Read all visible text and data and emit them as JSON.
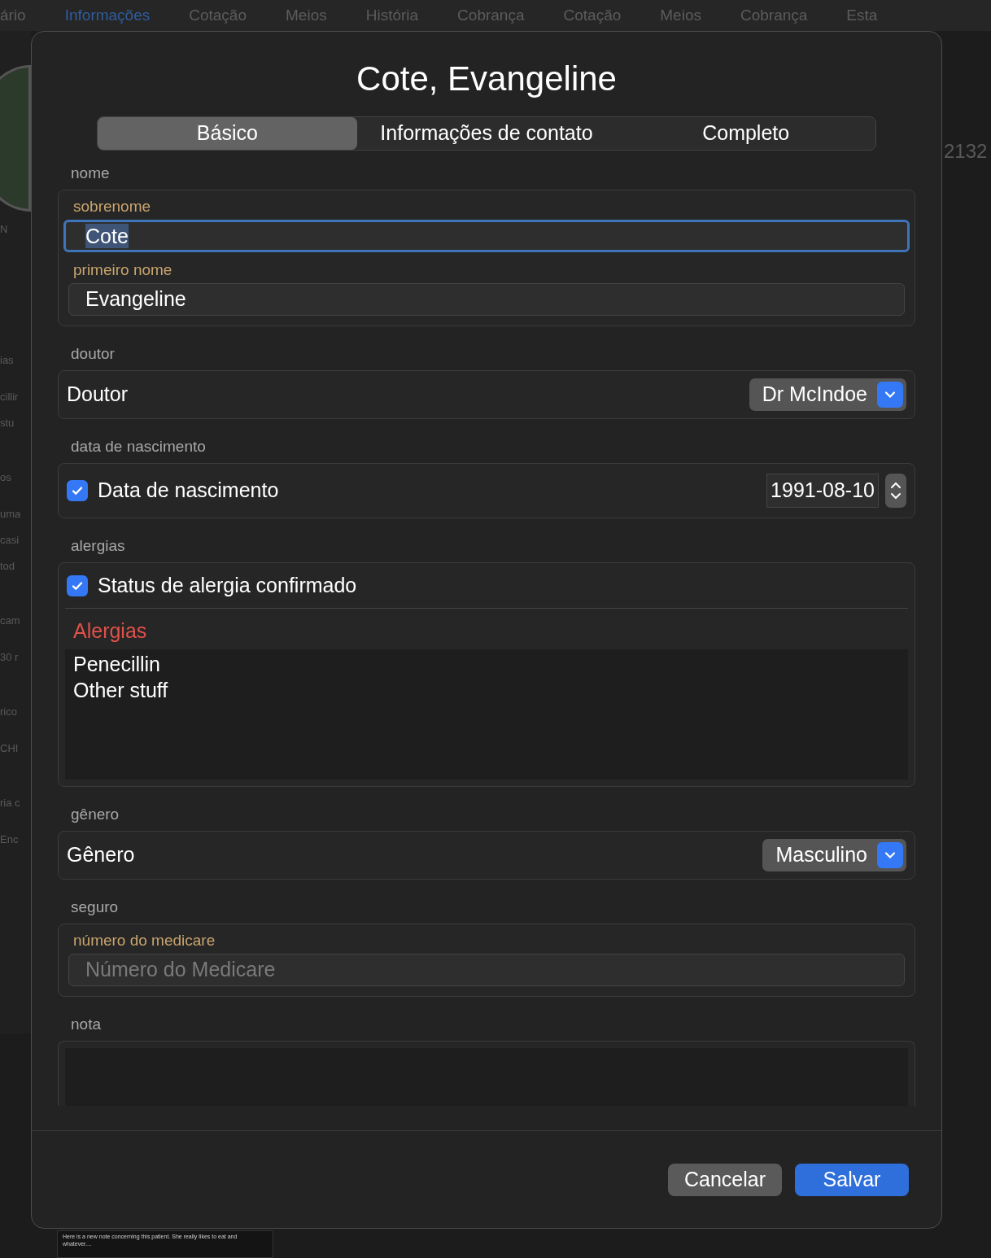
{
  "toolbar": {
    "items": [
      {
        "label": "ário",
        "selected": false
      },
      {
        "label": "Informações",
        "selected": true
      },
      {
        "label": "Cotação",
        "selected": false
      },
      {
        "label": "Meios",
        "selected": false
      },
      {
        "label": "História",
        "selected": false
      },
      {
        "label": "Cobrança",
        "selected": false
      },
      {
        "label": "Cotação",
        "selected": false
      },
      {
        "label": "Meios",
        "selected": false
      },
      {
        "label": "Cobrança",
        "selected": false
      },
      {
        "label": "Esta",
        "selected": false
      }
    ]
  },
  "background_column": [
    "N",
    "ias",
    "cillir",
    "stu",
    "os",
    "uma",
    "casi",
    "tod",
    "cam",
    "30 r",
    "rico",
    "CHI",
    "ria c",
    "Enc"
  ],
  "background_value": "2132",
  "background_note": "Here is a new note concerning this patient. She really likes to eat and whatever....",
  "dialog": {
    "title": "Cote, Evangeline",
    "tabs": [
      {
        "label": "Básico",
        "selected": true
      },
      {
        "label": "Informações de contato",
        "selected": false
      },
      {
        "label": "Completo",
        "selected": false
      }
    ],
    "sections": [
      {
        "kind": "fields",
        "heading": "nome",
        "fields": [
          {
            "label": "sobrenome",
            "value": "Cote",
            "focused": true
          },
          {
            "label": "primeiro nome",
            "value": "Evangeline",
            "focused": false
          }
        ]
      },
      {
        "kind": "picker",
        "heading": "doutor",
        "label": "Doutor",
        "value": "Dr McIndoe"
      },
      {
        "kind": "date",
        "heading": "data de nascimento",
        "label": "Data de nascimento",
        "checked": true,
        "value": "1991-08-10"
      },
      {
        "kind": "allergies",
        "heading": "alergias",
        "label": "Status de alergia confirmado",
        "checked": true,
        "list_title": "Alergias",
        "lines": [
          "Penecillin",
          "Other stuff"
        ]
      },
      {
        "kind": "picker",
        "heading": "gênero",
        "label": "Gênero",
        "value": "Masculino"
      },
      {
        "kind": "fields",
        "heading": "seguro",
        "fields": [
          {
            "label": "número do medicare",
            "placeholder": "Número do Medicare",
            "focused": false
          }
        ]
      },
      {
        "kind": "note",
        "heading": "nota"
      }
    ],
    "buttons": [
      {
        "label": "Cancelar",
        "kind": "secondary"
      },
      {
        "label": "Salvar",
        "kind": "primary"
      }
    ]
  }
}
